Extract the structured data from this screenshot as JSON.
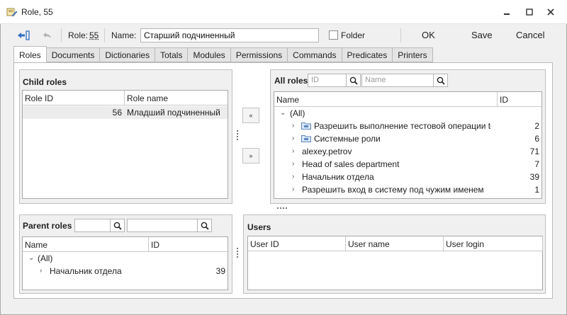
{
  "window": {
    "title": "Role, 55"
  },
  "toolbar": {
    "role_label": "Role:",
    "role_id": "55",
    "name_label": "Name:",
    "name_value": "Старший подчиненный",
    "folder_label": "Folder",
    "ok_label": "OK",
    "save_label": "Save",
    "cancel_label": "Cancel"
  },
  "tabs": [
    "Roles",
    "Documents",
    "Dictionaries",
    "Totals",
    "Modules",
    "Permissions",
    "Commands",
    "Predicates",
    "Printers"
  ],
  "child_roles": {
    "title": "Child roles",
    "columns": [
      "Role ID",
      "Role name"
    ],
    "rows": [
      {
        "id": "56",
        "name": "Младший подчиненный"
      }
    ]
  },
  "all_roles": {
    "title": "All roles",
    "id_placeholder": "ID",
    "name_placeholder": "Name",
    "columns": [
      "Name",
      "ID"
    ],
    "root": "(All)",
    "rows": [
      {
        "name": "Разрешить выполнение тестовой операции test",
        "id": "2",
        "folder": true
      },
      {
        "name": "Системные роли",
        "id": "6",
        "folder": true
      },
      {
        "name": "alexey.petrov",
        "id": "71",
        "folder": false
      },
      {
        "name": "Head of sales department",
        "id": "7",
        "folder": false
      },
      {
        "name": "Начальник отдела",
        "id": "39",
        "folder": false
      },
      {
        "name": "Разрешить вход в систему под чужим именем",
        "id": "1",
        "folder": false
      }
    ]
  },
  "parent_roles": {
    "title": "Parent roles",
    "columns": [
      "Name",
      "ID"
    ],
    "root": "(All)",
    "rows": [
      {
        "name": "Начальник отдела",
        "id": "39"
      }
    ]
  },
  "users": {
    "title": "Users",
    "columns": [
      "User ID",
      "User name",
      "User login"
    ]
  },
  "icons": {
    "app": "role-edit-icon",
    "back": "back-arrow-icon",
    "undo": "undo-icon",
    "search": "magnifier-icon"
  }
}
